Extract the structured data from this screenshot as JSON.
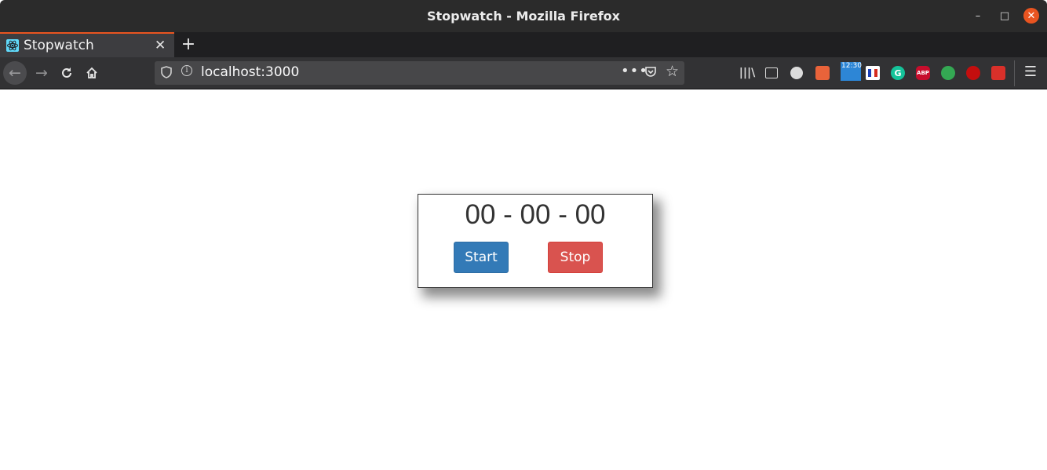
{
  "window": {
    "title": "Stopwatch - Mozilla Firefox",
    "controls": {
      "minimize": "–",
      "maximize": "□",
      "close": "✕"
    }
  },
  "tabs": [
    {
      "title": "Stopwatch",
      "favicon": "react-icon",
      "active": true
    }
  ],
  "tabstrip": {
    "new_tab_glyph": "+"
  },
  "navbar": {
    "url": "localhost:3000",
    "more_glyph": "•••",
    "toolbar_icons": [
      "library-icon",
      "sidebar-icon",
      "account-icon",
      "extension-icon",
      "clock-extension-icon",
      "flag-extension-icon",
      "grammarly-icon",
      "adblock-plus-icon",
      "green-extension-icon",
      "red-extension-icon",
      "extension-icon"
    ],
    "clock_text": "12:30",
    "abp_text": "ABP",
    "grammarly_text": "G"
  },
  "stopwatch": {
    "time": "00 - 00 - 00",
    "start_label": "Start",
    "stop_label": "Stop"
  },
  "colors": {
    "accent": "#e95420",
    "start_button": "#337ab7",
    "stop_button": "#d9534f",
    "titlebar": "#2b2b2b"
  }
}
